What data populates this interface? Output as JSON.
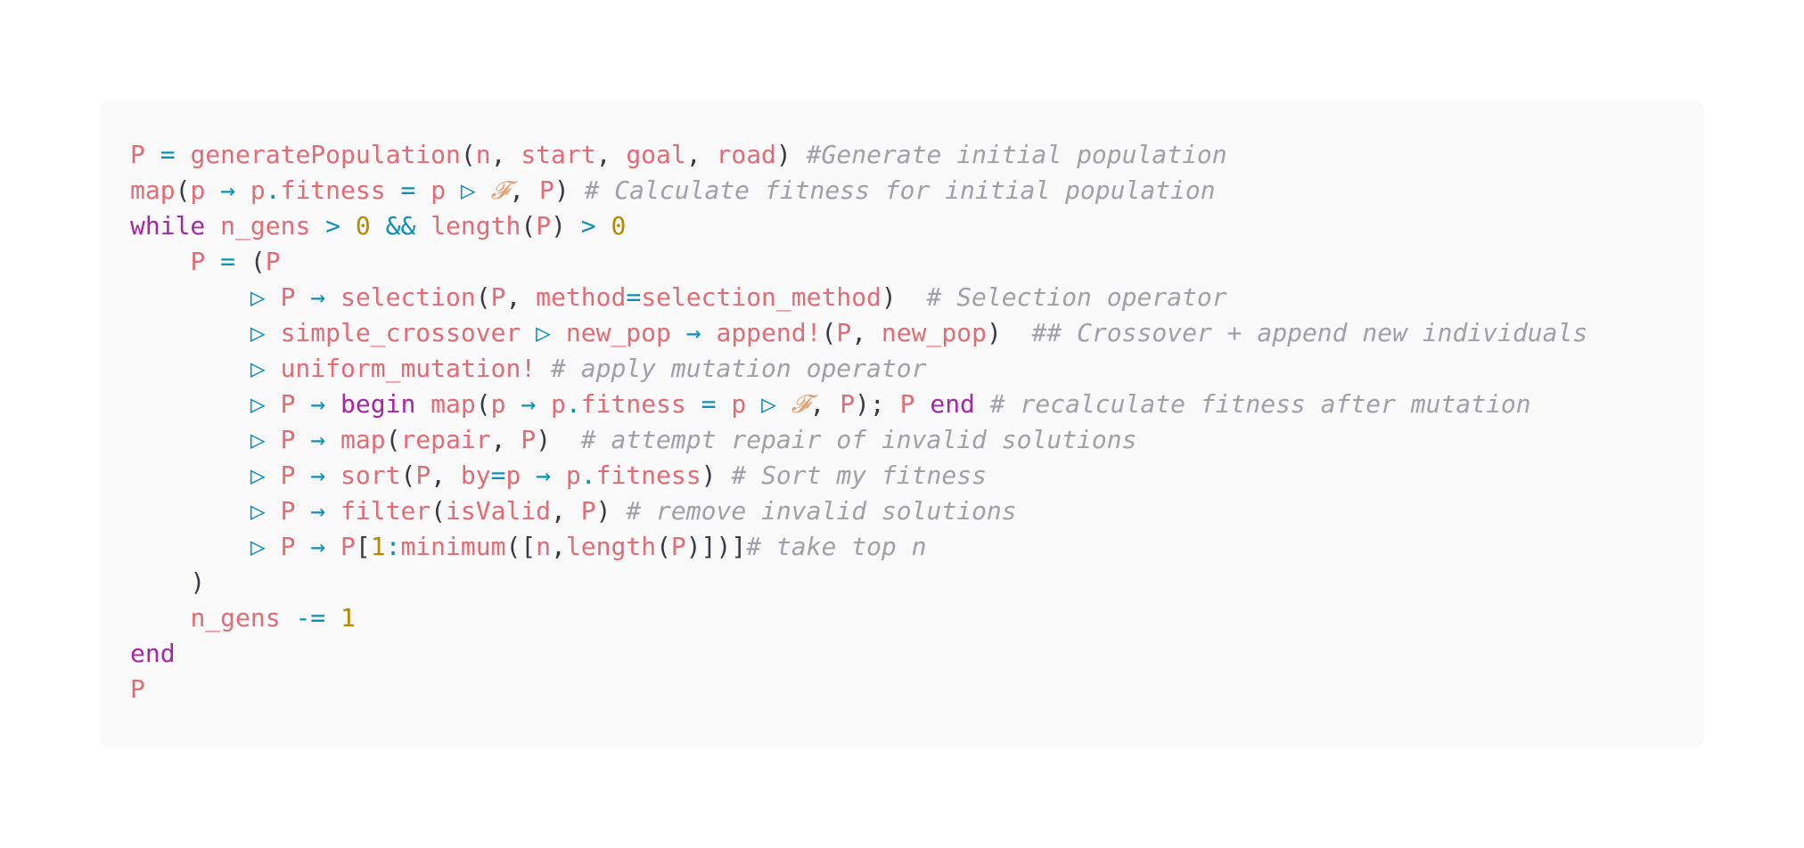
{
  "code": {
    "language": "julia",
    "lines": [
      [
        {
          "t": "P",
          "k": "var"
        },
        {
          "t": " ",
          "k": "pl"
        },
        {
          "t": "=",
          "k": "op"
        },
        {
          "t": " ",
          "k": "pl"
        },
        {
          "t": "generatePopulation",
          "k": "fn"
        },
        {
          "t": "(",
          "k": "pl"
        },
        {
          "t": "n",
          "k": "var"
        },
        {
          "t": ", ",
          "k": "pl"
        },
        {
          "t": "start",
          "k": "var"
        },
        {
          "t": ", ",
          "k": "pl"
        },
        {
          "t": "goal",
          "k": "var"
        },
        {
          "t": ", ",
          "k": "pl"
        },
        {
          "t": "road",
          "k": "var"
        },
        {
          "t": ") ",
          "k": "pl"
        },
        {
          "t": "#Generate initial population",
          "k": "cm"
        }
      ],
      [
        {
          "t": "map",
          "k": "fn"
        },
        {
          "t": "(",
          "k": "pl"
        },
        {
          "t": "p",
          "k": "var"
        },
        {
          "t": " → ",
          "k": "op"
        },
        {
          "t": "p",
          "k": "var"
        },
        {
          "t": ".",
          "k": "op"
        },
        {
          "t": "fitness",
          "k": "var"
        },
        {
          "t": " ",
          "k": "pl"
        },
        {
          "t": "=",
          "k": "op"
        },
        {
          "t": " ",
          "k": "pl"
        },
        {
          "t": "p",
          "k": "var"
        },
        {
          "t": " ▷ ",
          "k": "op"
        },
        {
          "t": "𝓕",
          "k": "sym"
        },
        {
          "t": ", ",
          "k": "pl"
        },
        {
          "t": "P",
          "k": "var"
        },
        {
          "t": ") ",
          "k": "pl"
        },
        {
          "t": "# Calculate fitness for initial population",
          "k": "cm"
        }
      ],
      [
        {
          "t": "while",
          "k": "kw"
        },
        {
          "t": " ",
          "k": "pl"
        },
        {
          "t": "n_gens",
          "k": "var"
        },
        {
          "t": " > ",
          "k": "op"
        },
        {
          "t": "0",
          "k": "num"
        },
        {
          "t": " && ",
          "k": "op"
        },
        {
          "t": "length",
          "k": "fn"
        },
        {
          "t": "(",
          "k": "pl"
        },
        {
          "t": "P",
          "k": "var"
        },
        {
          "t": ")",
          "k": "pl"
        },
        {
          "t": " > ",
          "k": "op"
        },
        {
          "t": "0",
          "k": "num"
        }
      ],
      [
        {
          "t": "    ",
          "k": "pl"
        },
        {
          "t": "P",
          "k": "var"
        },
        {
          "t": " = ",
          "k": "op"
        },
        {
          "t": "(",
          "k": "pl"
        },
        {
          "t": "P",
          "k": "var"
        }
      ],
      [
        {
          "t": "        ",
          "k": "pl"
        },
        {
          "t": "▷ ",
          "k": "op"
        },
        {
          "t": "P",
          "k": "var"
        },
        {
          "t": " → ",
          "k": "op"
        },
        {
          "t": "selection",
          "k": "fn"
        },
        {
          "t": "(",
          "k": "pl"
        },
        {
          "t": "P",
          "k": "var"
        },
        {
          "t": ", ",
          "k": "pl"
        },
        {
          "t": "method",
          "k": "var"
        },
        {
          "t": "=",
          "k": "op"
        },
        {
          "t": "selection_method",
          "k": "var"
        },
        {
          "t": ")  ",
          "k": "pl"
        },
        {
          "t": "# Selection operator",
          "k": "cm"
        }
      ],
      [
        {
          "t": "        ",
          "k": "pl"
        },
        {
          "t": "▷ ",
          "k": "op"
        },
        {
          "t": "simple_crossover",
          "k": "fn"
        },
        {
          "t": " ▷ ",
          "k": "op"
        },
        {
          "t": "new_pop",
          "k": "var"
        },
        {
          "t": " → ",
          "k": "op"
        },
        {
          "t": "append!",
          "k": "fn"
        },
        {
          "t": "(",
          "k": "pl"
        },
        {
          "t": "P",
          "k": "var"
        },
        {
          "t": ", ",
          "k": "pl"
        },
        {
          "t": "new_pop",
          "k": "var"
        },
        {
          "t": ")  ",
          "k": "pl"
        },
        {
          "t": "## Crossover + append new individuals",
          "k": "cm"
        }
      ],
      [
        {
          "t": "        ",
          "k": "pl"
        },
        {
          "t": "▷ ",
          "k": "op"
        },
        {
          "t": "uniform_mutation!",
          "k": "fn"
        },
        {
          "t": " ",
          "k": "pl"
        },
        {
          "t": "# apply mutation operator",
          "k": "cm"
        }
      ],
      [
        {
          "t": "        ",
          "k": "pl"
        },
        {
          "t": "▷ ",
          "k": "op"
        },
        {
          "t": "P",
          "k": "var"
        },
        {
          "t": " → ",
          "k": "op"
        },
        {
          "t": "begin",
          "k": "kw"
        },
        {
          "t": " ",
          "k": "pl"
        },
        {
          "t": "map",
          "k": "fn"
        },
        {
          "t": "(",
          "k": "pl"
        },
        {
          "t": "p",
          "k": "var"
        },
        {
          "t": " → ",
          "k": "op"
        },
        {
          "t": "p",
          "k": "var"
        },
        {
          "t": ".",
          "k": "op"
        },
        {
          "t": "fitness",
          "k": "var"
        },
        {
          "t": " = ",
          "k": "op"
        },
        {
          "t": "p",
          "k": "var"
        },
        {
          "t": " ▷ ",
          "k": "op"
        },
        {
          "t": "𝓕",
          "k": "sym"
        },
        {
          "t": ", ",
          "k": "pl"
        },
        {
          "t": "P",
          "k": "var"
        },
        {
          "t": "); ",
          "k": "pl"
        },
        {
          "t": "P",
          "k": "var"
        },
        {
          "t": " ",
          "k": "pl"
        },
        {
          "t": "end",
          "k": "kw"
        },
        {
          "t": " ",
          "k": "pl"
        },
        {
          "t": "# recalculate fitness after mutation",
          "k": "cm"
        }
      ],
      [
        {
          "t": "        ",
          "k": "pl"
        },
        {
          "t": "▷ ",
          "k": "op"
        },
        {
          "t": "P",
          "k": "var"
        },
        {
          "t": " → ",
          "k": "op"
        },
        {
          "t": "map",
          "k": "fn"
        },
        {
          "t": "(",
          "k": "pl"
        },
        {
          "t": "repair",
          "k": "var"
        },
        {
          "t": ", ",
          "k": "pl"
        },
        {
          "t": "P",
          "k": "var"
        },
        {
          "t": ")  ",
          "k": "pl"
        },
        {
          "t": "# attempt repair of invalid solutions",
          "k": "cm"
        }
      ],
      [
        {
          "t": "        ",
          "k": "pl"
        },
        {
          "t": "▷ ",
          "k": "op"
        },
        {
          "t": "P",
          "k": "var"
        },
        {
          "t": " → ",
          "k": "op"
        },
        {
          "t": "sort",
          "k": "fn"
        },
        {
          "t": "(",
          "k": "pl"
        },
        {
          "t": "P",
          "k": "var"
        },
        {
          "t": ", ",
          "k": "pl"
        },
        {
          "t": "by",
          "k": "var"
        },
        {
          "t": "=",
          "k": "op"
        },
        {
          "t": "p",
          "k": "var"
        },
        {
          "t": " → ",
          "k": "op"
        },
        {
          "t": "p",
          "k": "var"
        },
        {
          "t": ".",
          "k": "op"
        },
        {
          "t": "fitness",
          "k": "var"
        },
        {
          "t": ") ",
          "k": "pl"
        },
        {
          "t": "# Sort my fitness",
          "k": "cm"
        }
      ],
      [
        {
          "t": "        ",
          "k": "pl"
        },
        {
          "t": "▷ ",
          "k": "op"
        },
        {
          "t": "P",
          "k": "var"
        },
        {
          "t": " → ",
          "k": "op"
        },
        {
          "t": "filter",
          "k": "fn"
        },
        {
          "t": "(",
          "k": "pl"
        },
        {
          "t": "isValid",
          "k": "var"
        },
        {
          "t": ", ",
          "k": "pl"
        },
        {
          "t": "P",
          "k": "var"
        },
        {
          "t": ") ",
          "k": "pl"
        },
        {
          "t": "# remove invalid solutions",
          "k": "cm"
        }
      ],
      [
        {
          "t": "        ",
          "k": "pl"
        },
        {
          "t": "▷ ",
          "k": "op"
        },
        {
          "t": "P",
          "k": "var"
        },
        {
          "t": " → ",
          "k": "op"
        },
        {
          "t": "P",
          "k": "var"
        },
        {
          "t": "[",
          "k": "pl"
        },
        {
          "t": "1",
          "k": "num"
        },
        {
          "t": ":",
          "k": "op"
        },
        {
          "t": "minimum",
          "k": "fn"
        },
        {
          "t": "([",
          "k": "pl"
        },
        {
          "t": "n",
          "k": "var"
        },
        {
          "t": ",",
          "k": "pl"
        },
        {
          "t": "length",
          "k": "fn"
        },
        {
          "t": "(",
          "k": "pl"
        },
        {
          "t": "P",
          "k": "var"
        },
        {
          "t": ")])]",
          "k": "pl"
        },
        {
          "t": "# take top n",
          "k": "cm"
        }
      ],
      [
        {
          "t": "    )",
          "k": "pl"
        }
      ],
      [
        {
          "t": "    ",
          "k": "pl"
        },
        {
          "t": "n_gens",
          "k": "var"
        },
        {
          "t": " -= ",
          "k": "op"
        },
        {
          "t": "1",
          "k": "num"
        }
      ],
      [
        {
          "t": "end",
          "k": "kw"
        }
      ],
      [
        {
          "t": "P",
          "k": "var"
        }
      ]
    ]
  },
  "colors": {
    "background": "#ffffff",
    "panel": "#f9f9f9",
    "identifier": "#e06c75",
    "keyword": "#a626a4",
    "operator": "#0e8fb8",
    "number": "#b58900",
    "comment": "#a0a1a7",
    "plain": "#383a42"
  }
}
